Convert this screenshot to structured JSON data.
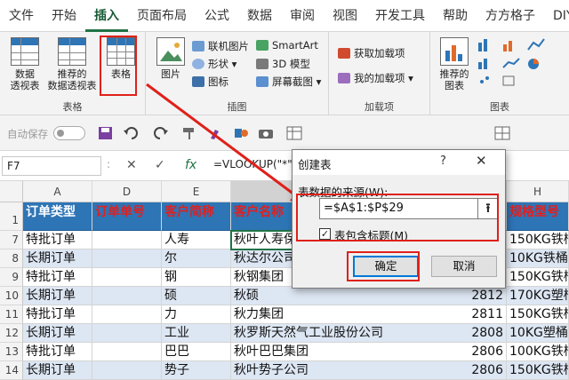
{
  "menu": {
    "items": [
      "文件",
      "开始",
      "插入",
      "页面布局",
      "公式",
      "数据",
      "审阅",
      "视图",
      "开发工具",
      "帮助",
      "方方格子",
      "DIY"
    ],
    "active_index": 2
  },
  "ribbon": {
    "groups": {
      "table": {
        "label": "表格",
        "pivot_label": "数据\n透视表",
        "recommended_pivot_label": "推荐的\n数据透视表",
        "table_label": "表格"
      },
      "illustrations": {
        "label": "插图",
        "picture_label": "图片",
        "online_picture_label": "联机图片",
        "shapes_label": "形状 ▾",
        "icons_label": "图标",
        "smartart_label": "SmartArt",
        "model3d_label": "3D 模型",
        "screenshot_label": "屏幕截图 ▾"
      },
      "addins": {
        "label": "加载项",
        "get_addins_label": "获取加载项",
        "my_addins_label": "我的加载项 ▾"
      },
      "charts": {
        "label": "图表",
        "recommended_charts_label": "推荐的\n图表"
      }
    }
  },
  "qat": {
    "autosave_label": "自动保存",
    "autosave_state": "●  关"
  },
  "formula_bar": {
    "name_box": "F7",
    "fx": "fx",
    "formula": "=VLOOKUP(\"*\"",
    "cancel": "✕",
    "enter": "✓",
    "colon": ":"
  },
  "grid": {
    "columns": [
      "A",
      "D",
      "E",
      "F",
      "H"
    ],
    "headers": [
      "订单类型",
      "订单单号",
      "客户简称",
      "客户名称",
      "规格型号"
    ],
    "rows": [
      {
        "num": "1",
        "a": "",
        "d": "",
        "e": "",
        "f": "",
        "g": "",
        "h": ""
      },
      {
        "num": "7",
        "a": "特批订单",
        "d": "",
        "e": "人寿",
        "f": "秋叶人寿保",
        "g": "",
        "h": "150KG铁桶"
      },
      {
        "num": "8",
        "a": "长期订单",
        "d": "",
        "e": "尔",
        "f": "秋达尔公司",
        "g": "",
        "h": "10KG铁桶"
      },
      {
        "num": "9",
        "a": "特批订单",
        "d": "",
        "e": "钢",
        "f": "秋钢集团",
        "g": "",
        "h": "150KG铁桶"
      },
      {
        "num": "10",
        "a": "长期订单",
        "d": "",
        "e": "硕",
        "f": "秋硕",
        "g": "2812",
        "h": "170KG塑桶"
      },
      {
        "num": "11",
        "a": "特批订单",
        "d": "",
        "e": "力",
        "f": "秋力集团",
        "g": "2811",
        "h": "150KG铁桶"
      },
      {
        "num": "12",
        "a": "长期订单",
        "d": "",
        "e": "工业",
        "f": "秋罗斯天然气工业股份公司",
        "g": "2808",
        "h": "10KG塑桶"
      },
      {
        "num": "13",
        "a": "特批订单",
        "d": "",
        "e": "巴巴",
        "f": "秋叶巴巴集团",
        "g": "2806",
        "h": "100KG铁桶"
      },
      {
        "num": "14",
        "a": "长期订单",
        "d": "",
        "e": "势子",
        "f": "秋叶势子公司",
        "g": "2806",
        "h": "150KG铁桶"
      }
    ]
  },
  "dialog": {
    "title": "创建表",
    "help": "?",
    "close": "✕",
    "source_label": "表数据的来源(W):",
    "source_value": "=$A$1:$P$29",
    "collapse_icon": "⭱",
    "has_headers_label": "表包含标题(M)",
    "has_headers_checked": "✓",
    "ok_label": "确定",
    "cancel_label": "取消"
  },
  "colors": {
    "accent": "#217346",
    "header_fill": "#2e75b6",
    "highlight": "#e0201a"
  }
}
